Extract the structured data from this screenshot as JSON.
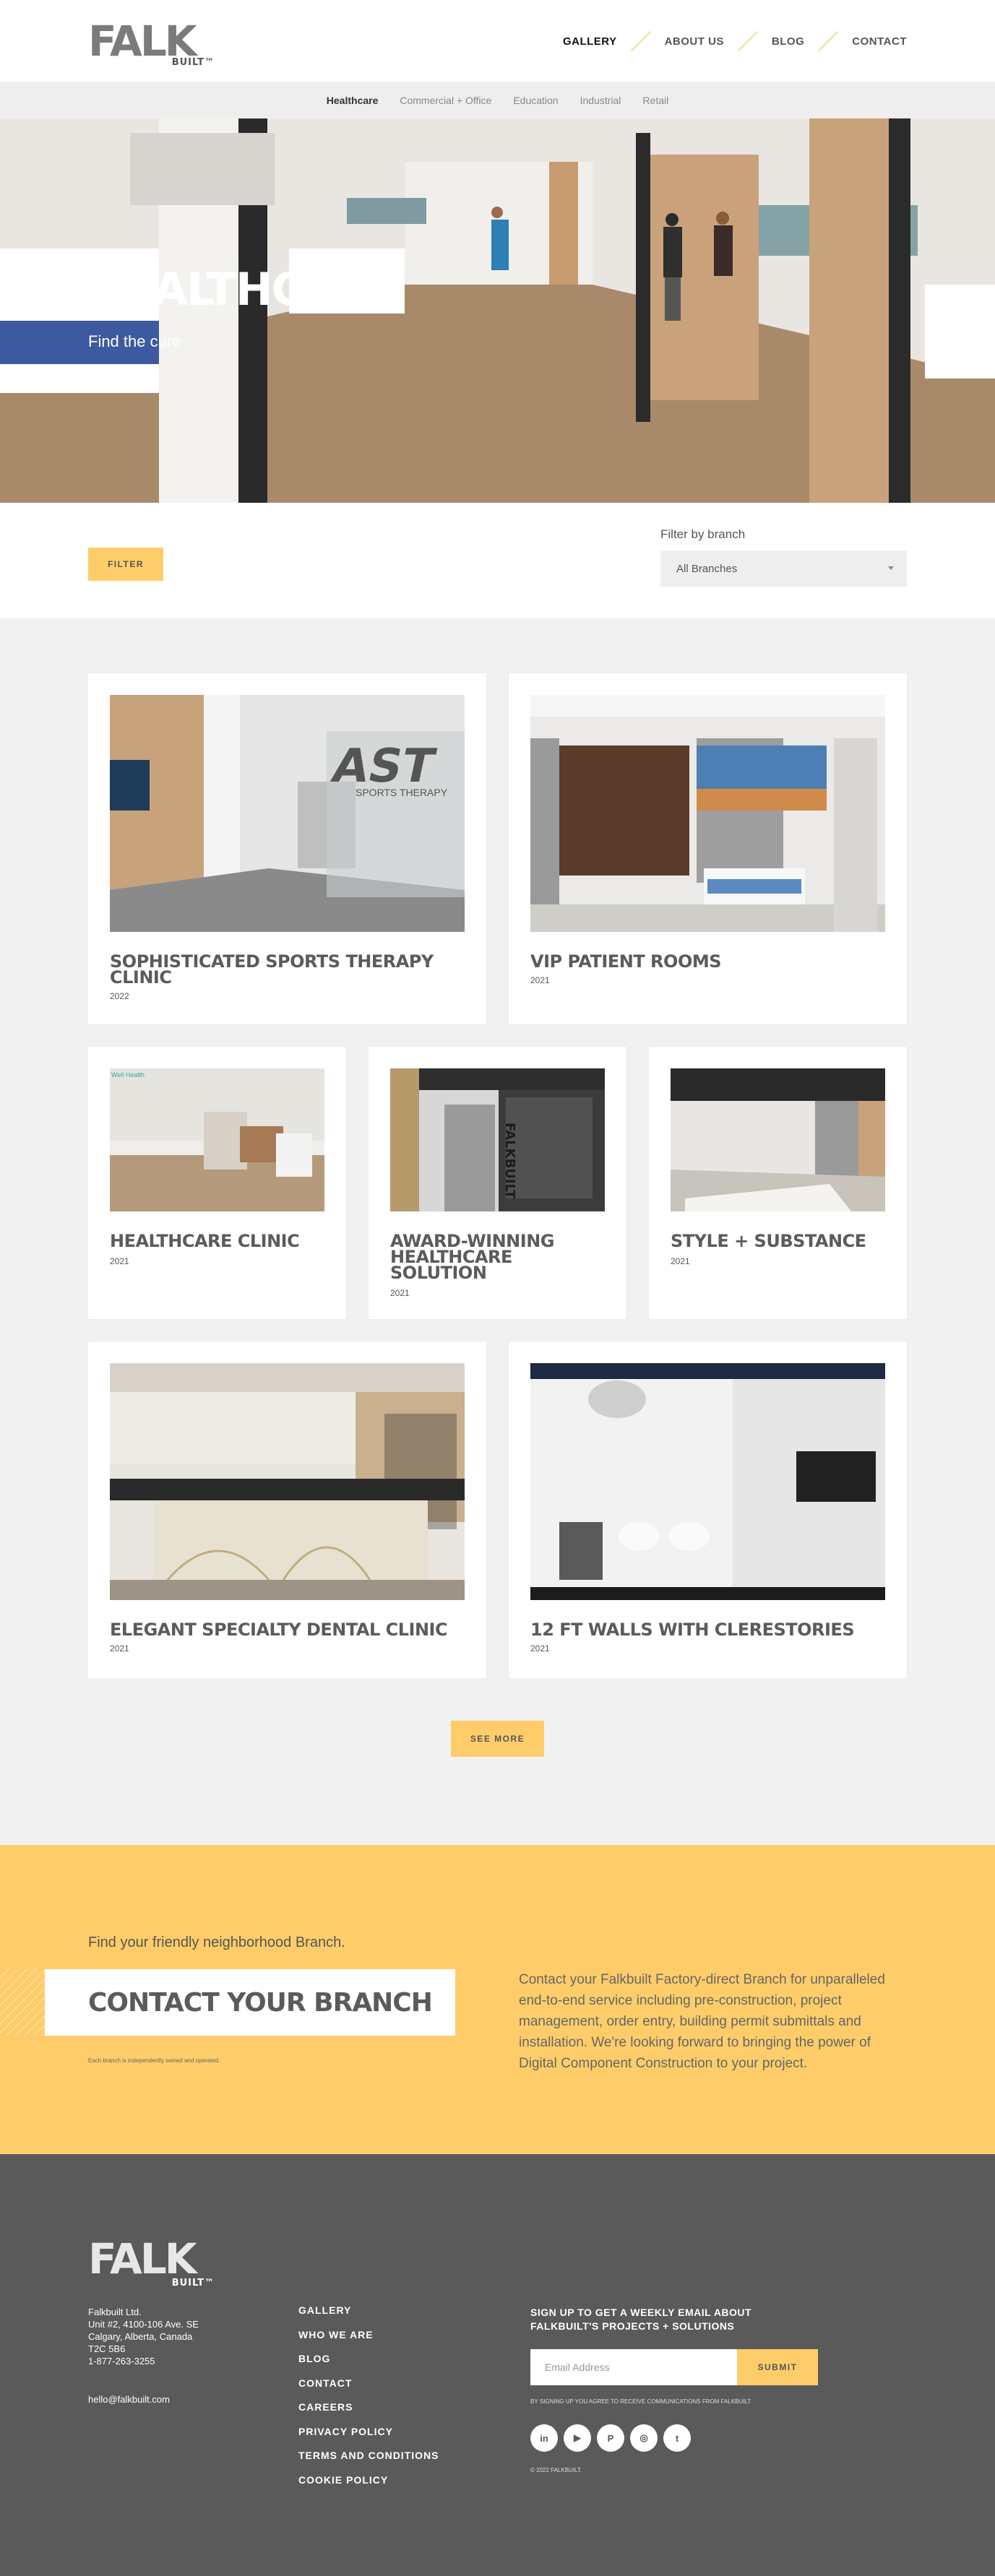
{
  "header": {
    "logo_text": "FALK",
    "logo_sub": "BUILT™",
    "nav": [
      {
        "label": "GALLERY",
        "active": true
      },
      {
        "label": "ABOUT US",
        "active": false
      },
      {
        "label": "BLOG",
        "active": false
      },
      {
        "label": "CONTACT",
        "active": false
      }
    ]
  },
  "subnav": [
    "Healthcare",
    "Commercial + Office",
    "Education",
    "Industrial",
    "Retail"
  ],
  "hero": {
    "title": "HEALTHCARE",
    "subtitle": "Find the cure"
  },
  "filters": {
    "filter_label": "FILTER",
    "branch_label": "Filter by branch",
    "branch_value": "All Branches"
  },
  "projects": [
    {
      "title": "SOPHISTICATED SPORTS THERAPY CLINIC",
      "year": "2022",
      "sign_text": "AST",
      "sign_sub": "SPORTS THERAPY"
    },
    {
      "title": "VIP PATIENT ROOMS",
      "year": "2021"
    },
    {
      "title": "HEALTHCARE CLINIC",
      "year": "2021"
    },
    {
      "title": "AWARD-WINNING HEALTHCARE SOLUTION",
      "year": "2021",
      "sign_text": "FALKBUILT"
    },
    {
      "title": "STYLE + SUBSTANCE",
      "year": "2021"
    },
    {
      "title": "ELEGANT SPECIALTY DENTAL CLINIC",
      "year": "2021"
    },
    {
      "title": "12 FT WALLS WITH CLERESTORIES",
      "year": "2021"
    }
  ],
  "see_more": "SEE MORE",
  "contact": {
    "find_text": "Find your friendly neighborhood Branch.",
    "heading": "CONTACT YOUR BRANCH",
    "note": "Each branch is independently owned and operated.",
    "paragraph": "Contact your Falkbuilt Factory-direct Branch for unparalleled end-to-end service including pre-construction, project management, order entry, building permit submittals and installation. We're looking forward to bringing the power of Digital Component Construction to your project."
  },
  "footer": {
    "logo_text": "FALK",
    "logo_sub": "BUILT™",
    "address": [
      "Falkbuilt Ltd.",
      "Unit #2, 4100-106 Ave. SE",
      "Calgary, Alberta, Canada",
      "T2C 5B6",
      "1-877-263-3255"
    ],
    "email": "hello@falkbuilt.com",
    "links": [
      "GALLERY",
      "WHO WE ARE",
      "BLOG",
      "CONTACT",
      "CAREERS",
      "PRIVACY POLICY",
      "TERMS AND CONDITIONS",
      "COOKIE POLICY"
    ],
    "signup_title": "SIGN UP TO GET A WEEKLY EMAIL ABOUT FALKBUILT'S PROJECTS + SOLUTIONS",
    "email_placeholder": "Email Address",
    "submit_label": "SUBMIT",
    "consent": "BY SIGNING UP YOU AGREE TO RECEIVE COMMUNICATIONS FROM FALKBUILT",
    "socials": [
      {
        "name": "linkedin-icon",
        "glyph": "in"
      },
      {
        "name": "youtube-icon",
        "glyph": "▶"
      },
      {
        "name": "pinterest-icon",
        "glyph": "P"
      },
      {
        "name": "instagram-icon",
        "glyph": "◎"
      },
      {
        "name": "twitter-icon",
        "glyph": "t"
      }
    ],
    "copyright": "© 2022 FALKBUILT."
  },
  "colors": {
    "accent": "#fecd6a",
    "footer_bg": "#5a5a5a",
    "page_bg": "#f1f1f1"
  }
}
